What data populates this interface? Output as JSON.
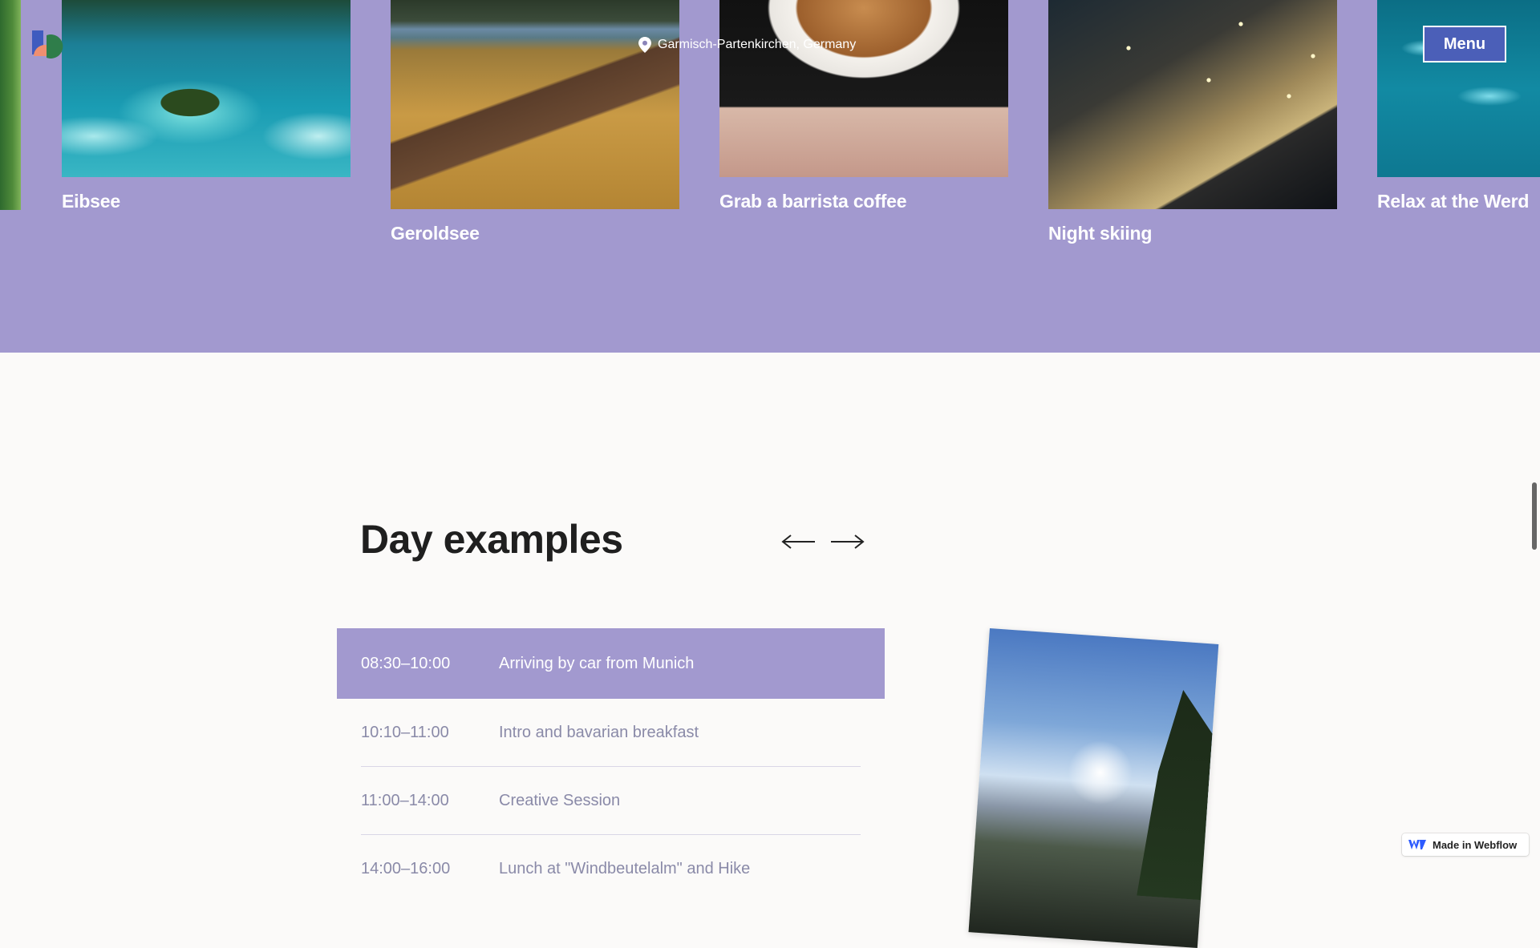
{
  "header": {
    "location": "Garmisch-Partenkirchen, Germany",
    "menu_label": "Menu",
    "logo_icon": "brand-logo-icon",
    "pin_icon": "map-pin-icon"
  },
  "gallery": {
    "cards": [
      {
        "title": "Eibsee"
      },
      {
        "title": "Geroldsee"
      },
      {
        "title": "Grab a barrista coffee"
      },
      {
        "title": "Night skiing"
      },
      {
        "title": "Relax at the Werd"
      }
    ]
  },
  "day_examples": {
    "title": "Day examples",
    "prev_icon": "arrow-left-icon",
    "next_icon": "arrow-right-icon",
    "schedule": [
      {
        "time": "08:30–10:00",
        "activity": "Arriving by car from Munich"
      },
      {
        "time": "10:10–11:00",
        "activity": "Intro and bavarian breakfast"
      },
      {
        "time": "11:00–14:00",
        "activity": "Creative Session"
      },
      {
        "time": "14:00–16:00",
        "activity": "Lunch at \"Windbeutelalm\" and Hike"
      }
    ]
  },
  "badge": {
    "label": "Made in Webflow"
  },
  "colors": {
    "hero_bg": "#a299cf",
    "menu_bg": "#4b5fb8",
    "page_bg": "#fbfaf9",
    "muted_text": "#8a8aa8"
  }
}
